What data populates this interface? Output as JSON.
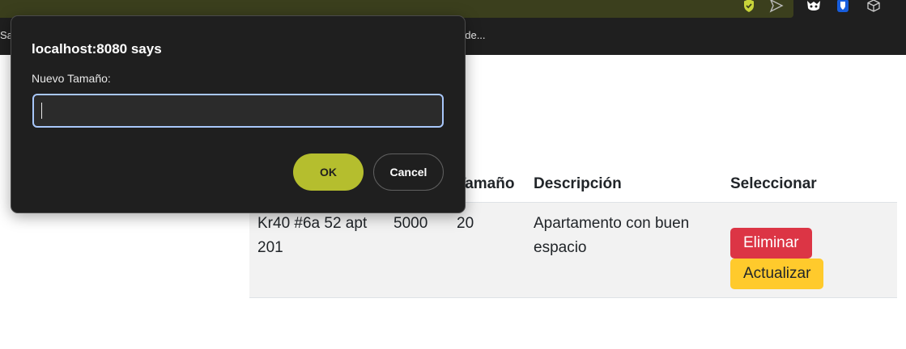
{
  "browser": {
    "bookmark_left": "Sa",
    "bookmark_right": "ade...",
    "icons": [
      "shield-check-icon",
      "send-icon",
      "extension-mask-icon",
      "bitwarden-icon",
      "cube-icon"
    ]
  },
  "dialog": {
    "title": "localhost:8080 says",
    "message": "Nuevo Tamaño:",
    "input_value": "",
    "ok_label": "OK",
    "cancel_label": "Cancel"
  },
  "table": {
    "headers": [
      "",
      "",
      "Tamaño",
      "Descripción",
      "Seleccionar"
    ],
    "rows": [
      {
        "direccion": "Kr40 #6a 52 apt 201",
        "precio": "5000",
        "tamano": "20",
        "descripcion": "Apartamento con buen espacio",
        "delete_label": "Eliminar",
        "update_label": "Actualizar"
      }
    ]
  },
  "colors": {
    "danger": "#dc3545",
    "warning": "#ffca2c",
    "ok_button": "#b5be2e",
    "dialog_bg": "#1f1f1f",
    "input_focus": "#a8c7fa"
  }
}
